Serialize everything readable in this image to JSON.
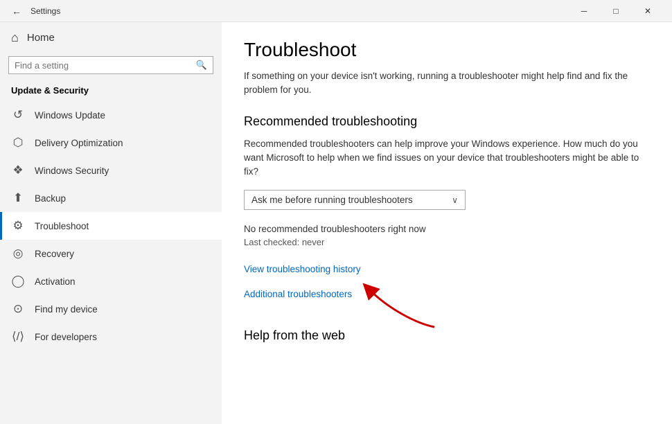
{
  "titlebar": {
    "back_label": "←",
    "title": "Settings",
    "minimize": "─",
    "maximize": "□",
    "close": "✕"
  },
  "sidebar": {
    "home_label": "Home",
    "search_placeholder": "Find a setting",
    "section_title": "Update & Security",
    "items": [
      {
        "id": "windows-update",
        "label": "Windows Update",
        "icon": "↺"
      },
      {
        "id": "delivery-optimization",
        "label": "Delivery Optimization",
        "icon": "⊡"
      },
      {
        "id": "windows-security",
        "label": "Windows Security",
        "icon": "🛡"
      },
      {
        "id": "backup",
        "label": "Backup",
        "icon": "↑"
      },
      {
        "id": "troubleshoot",
        "label": "Troubleshoot",
        "icon": "🔧",
        "active": true
      },
      {
        "id": "recovery",
        "label": "Recovery",
        "icon": "👤"
      },
      {
        "id": "activation",
        "label": "Activation",
        "icon": "✓"
      },
      {
        "id": "find-my-device",
        "label": "Find my device",
        "icon": "⊙"
      },
      {
        "id": "for-developers",
        "label": "For developers",
        "icon": "⟨⟩"
      }
    ]
  },
  "content": {
    "page_title": "Troubleshoot",
    "page_desc": "If something on your device isn't working, running a troubleshooter might help find and fix the problem for you.",
    "recommended_title": "Recommended troubleshooting",
    "recommended_desc": "Recommended troubleshooters can help improve your Windows experience. How much do you want Microsoft to help when we find issues on your device that troubleshooters might be able to fix?",
    "dropdown_value": "Ask me before running troubleshooters",
    "status_text": "No recommended troubleshooters right now",
    "last_checked": "Last checked: never",
    "view_history_link": "View troubleshooting history",
    "additional_link": "Additional troubleshooters",
    "help_title": "Help from the web"
  }
}
